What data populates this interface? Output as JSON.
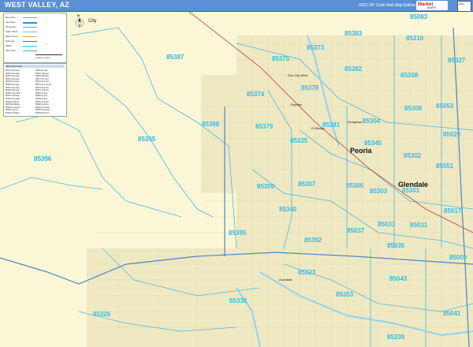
{
  "header": {
    "title": "WEST VALLEY, AZ",
    "edition": "2023 ZIP Code Wall Map Edition",
    "logo_text": "Market",
    "logo_sub": "MAPS",
    "corner_text": "2023"
  },
  "map": {
    "background_color": "#fbf7d6",
    "zip_label_color": "#2fb3d6",
    "boundary_color": "#4ab8e0",
    "highway_color": "#4a86c8",
    "railroad_color": "#c63a3a",
    "water_color": "#8fd3f0"
  },
  "zip_codes": [
    {
      "code": "85083"
    },
    {
      "code": "85383"
    },
    {
      "code": "85310"
    },
    {
      "code": "85387"
    },
    {
      "code": "85375"
    },
    {
      "code": "85373"
    },
    {
      "code": "85027"
    },
    {
      "code": "85382"
    },
    {
      "code": "85308"
    },
    {
      "code": "85374"
    },
    {
      "code": "85378"
    },
    {
      "code": "85053"
    },
    {
      "code": "85306"
    },
    {
      "code": "85388"
    },
    {
      "code": "85379"
    },
    {
      "code": "85381"
    },
    {
      "code": "85304"
    },
    {
      "code": "85029"
    },
    {
      "code": "85355"
    },
    {
      "code": "85335"
    },
    {
      "code": "85345"
    },
    {
      "code": "85396"
    },
    {
      "code": "85302"
    },
    {
      "code": "85051"
    },
    {
      "code": "85309"
    },
    {
      "code": "85307"
    },
    {
      "code": "85305"
    },
    {
      "code": "85303"
    },
    {
      "code": "85301"
    },
    {
      "code": "85340"
    },
    {
      "code": "85017"
    },
    {
      "code": "85037"
    },
    {
      "code": "85033"
    },
    {
      "code": "85031"
    },
    {
      "code": "85395"
    },
    {
      "code": "85392"
    },
    {
      "code": "85035"
    },
    {
      "code": "85009"
    },
    {
      "code": "85323"
    },
    {
      "code": "85043"
    },
    {
      "code": "85353"
    },
    {
      "code": "85338"
    },
    {
      "code": "85326"
    },
    {
      "code": "85041"
    },
    {
      "code": "85339"
    }
  ],
  "cities": {
    "peoria": "Peoria",
    "glendale": "Glendale",
    "sun_city_west": "Sun City West",
    "surprise": "Surprise",
    "avondale": "Avondale",
    "el_mirage": "El Mirage",
    "youngtown": "Youngtown",
    "city_label": "City"
  },
  "legend": {
    "rows": [
      "Boundary",
      "Interstate",
      "US Route",
      "State Route",
      "Major Road",
      "Railroad",
      "Water",
      "ZIP Code"
    ],
    "scale_label": "Scale in miles"
  },
  "index_box": {
    "title": "ZIP Code Index",
    "entries": [
      "85301 Glendale",
      "85302 Glendale",
      "85303 Glendale",
      "85304 Glendale",
      "85305 Glendale",
      "85306 Glendale",
      "85307 Glendale",
      "85308 Glendale",
      "85309 Luke AFB",
      "85310 Glendale",
      "85323 Avondale",
      "85326 Buckeye",
      "85335 El Mirage",
      "85338 Goodyear",
      "85339 Laveen",
      "85340 Litchfield",
      "85345 Peoria",
      "85353 Tolleson",
      "85355 Waddell",
      "85373 Sun City",
      "85374 Surprise",
      "85375 Sun City W",
      "85378 Surprise",
      "85379 Surprise",
      "85381 Peoria",
      "85382 Peoria",
      "85383 Peoria",
      "85387 Surprise",
      "85388 Surprise",
      "85392 Avondale",
      "85395 Goodyear",
      "85396 Buckeye"
    ]
  },
  "compass": {
    "north_label": "N"
  }
}
